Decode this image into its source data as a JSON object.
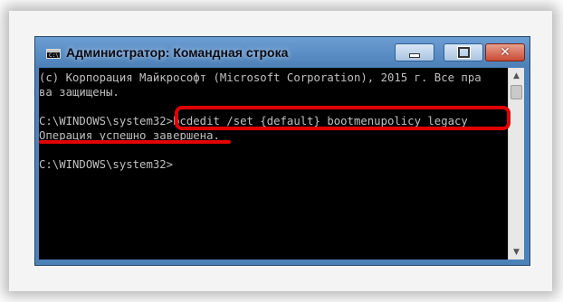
{
  "window": {
    "title": "Администратор: Командная строка",
    "icon": "cmd-icon"
  },
  "console": {
    "lines": [
      "(c) Корпорация Майкрософт (Microsoft Corporation), 2015 г. Все пра",
      "ва защищены.",
      "",
      "C:\\WINDOWS\\system32>bcdedit /set {default} bootmenupolicy legacy",
      "Операция успешно завершена.",
      "",
      "C:\\WINDOWS\\system32>"
    ]
  },
  "icons": {
    "minimize": "minimize-icon",
    "maximize": "maximize-icon",
    "close": "close-icon"
  },
  "colors": {
    "console_bg": "#000000",
    "console_text": "#c0c0c0",
    "annotation": "#e10000",
    "titlebar": "#5a8cc4"
  }
}
